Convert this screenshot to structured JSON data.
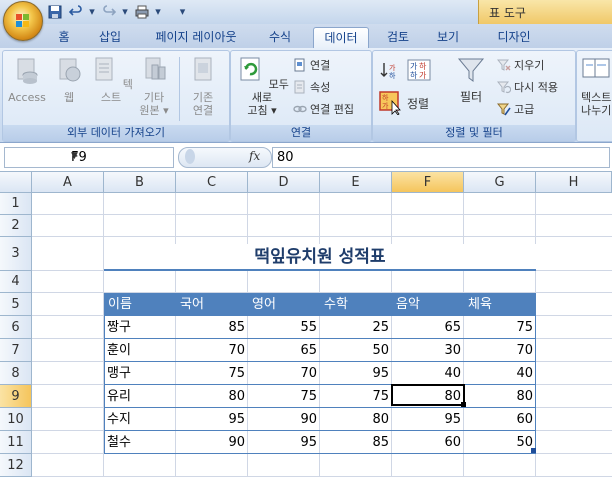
{
  "title_bar": {
    "context_tab": "표 도구"
  },
  "tabs": [
    {
      "label": "홈"
    },
    {
      "label": "삽입"
    },
    {
      "label": "페이지 레이아웃"
    },
    {
      "label": "수식"
    },
    {
      "label": "데이터",
      "active": true
    },
    {
      "label": "검토"
    },
    {
      "label": "보기"
    },
    {
      "label": "디자인"
    }
  ],
  "ribbon": {
    "external_data": {
      "label": "외부 데이터 가져오기",
      "access": "Access",
      "web": "웹",
      "text": "텍스트",
      "other_line1": "기타",
      "other_line2": "원본",
      "existing_line1": "기존",
      "existing_line2": "연결"
    },
    "connections": {
      "label": "연결",
      "refresh_line1": "모두 새로",
      "refresh_line2": "고침",
      "connections": "연결",
      "properties": "속성",
      "edit_links": "연결 편집"
    },
    "sort_filter": {
      "label": "정렬 및 필터",
      "sort": "정렬",
      "filter": "필터",
      "clear": "지우기",
      "reapply": "다시 적용",
      "advanced": "고급"
    },
    "data_tools": {
      "text_line1": "텍스트",
      "text_line2": "나누기"
    }
  },
  "formula_bar": {
    "name_box": "F9",
    "fx": "fx",
    "formula": "80"
  },
  "columns": [
    "A",
    "B",
    "C",
    "D",
    "E",
    "F",
    "G",
    "H"
  ],
  "rows": [
    "1",
    "2",
    "3",
    "4",
    "5",
    "6",
    "7",
    "8",
    "9",
    "10",
    "11",
    "12"
  ],
  "sheet": {
    "title": "떡잎유치원 성적표",
    "headers": [
      "이름",
      "국어",
      "영어",
      "수학",
      "음악",
      "체육"
    ],
    "data": [
      [
        "짱구",
        "85",
        "55",
        "25",
        "65",
        "75"
      ],
      [
        "훈이",
        "70",
        "65",
        "50",
        "30",
        "70"
      ],
      [
        "맹구",
        "75",
        "70",
        "95",
        "40",
        "40"
      ],
      [
        "유리",
        "80",
        "75",
        "75",
        "80",
        "80"
      ],
      [
        "수지",
        "95",
        "90",
        "80",
        "95",
        "60"
      ],
      [
        "철수",
        "90",
        "95",
        "85",
        "60",
        "50"
      ]
    ]
  },
  "selection": {
    "column": "F",
    "row": "9"
  },
  "colors": {
    "table_accent": "#4f81bd",
    "selected_header": "#f5c55c",
    "title_text": "#1f3d6b"
  }
}
